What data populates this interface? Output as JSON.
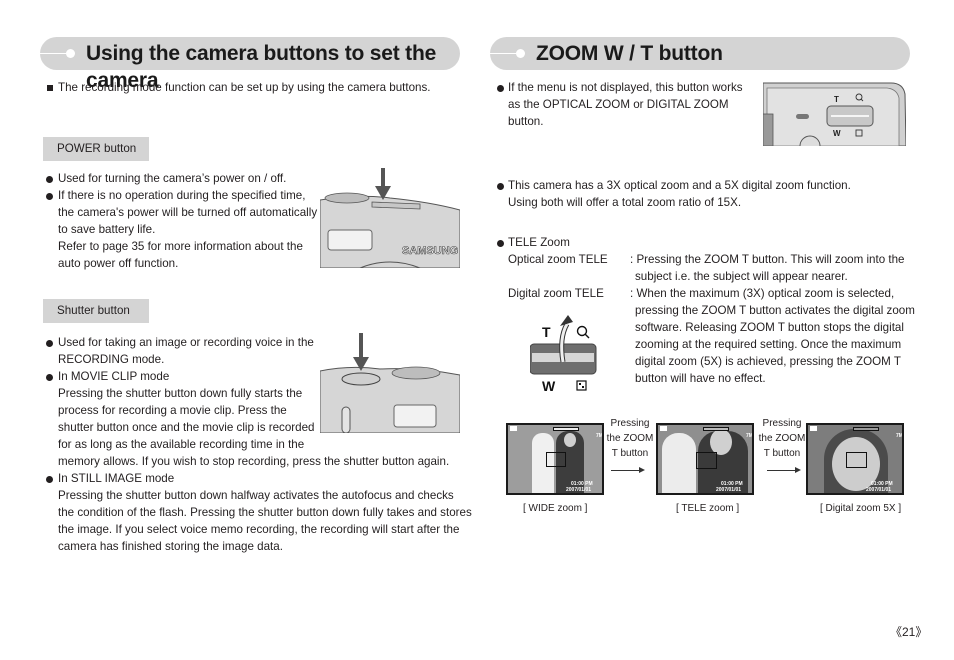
{
  "left": {
    "title": "Using the camera buttons to set the camera",
    "intro": "The recording mode function can be set up by using the camera buttons.",
    "power": {
      "label": "POWER button",
      "bullets": [
        [
          "Used for turning the camera’s power on / off."
        ],
        [
          "If there is no operation during the specified time,",
          "the camera's power will be turned off automatically",
          "to save battery life.",
          "Refer to page 35 for more information about the",
          "auto power off function."
        ]
      ],
      "illustration_brand": "SAMSUNG"
    },
    "shutter": {
      "label": "Shutter button",
      "bullets": [
        [
          "Used for taking an image or recording voice in the",
          "RECORDING mode."
        ],
        [
          "In MOVIE CLIP mode",
          "Pressing the shutter button down fully starts the",
          "process for recording a movie clip. Press the",
          "shutter button once and the movie clip is recorded",
          "for as long as the available recording time in the",
          "memory allows. If you wish to stop recording, press the shutter button again."
        ],
        [
          "In STILL IMAGE mode",
          "Pressing the shutter button down halfway activates the autofocus and checks",
          "the condition of the flash. Pressing the shutter button down fully takes and stores",
          "the image. If you select voice memo recording, the recording will start after the",
          "camera has finished storing the image data."
        ]
      ]
    }
  },
  "right": {
    "title": "ZOOM W / T button",
    "bullet1": [
      "If the menu is not displayed, this button works",
      "as the OPTICAL ZOOM or DIGITAL ZOOM",
      "button."
    ],
    "bullet2": [
      "This camera has a 3X optical zoom and a 5X digital zoom function.",
      "Using both will offer a total zoom ratio of 15X."
    ],
    "tele": {
      "heading": "TELE Zoom",
      "rows": [
        {
          "term": "Optical zoom TELE",
          "desc": [
            ": Pressing the ZOOM T button. This will zoom into the",
            "subject i.e. the subject will appear nearer."
          ]
        },
        {
          "term": "Digital zoom TELE",
          "desc": [
            ": When the maximum (3X) optical zoom is selected,",
            "pressing the ZOOM T button activates the digital zoom",
            "software. Releasing ZOOM T button stops the digital",
            "zooming at the required setting. Once the maximum",
            "digital zoom (5X) is achieved, pressing the ZOOM T",
            "button will have no effect."
          ]
        }
      ]
    },
    "button_labels": {
      "tele": "T",
      "wide": "W",
      "tele_icon": "magnifier-icon",
      "wide_icon": "thumbnail-grid-icon"
    },
    "sequence": {
      "shots": [
        {
          "caption": "[ WIDE zoom ]",
          "osd_time": "01:00 PM",
          "osd_date": "2007/01/01",
          "osd_size": "7M"
        },
        {
          "caption": "[ TELE zoom ]",
          "osd_time": "01:00 PM",
          "osd_date": "2007/01/01",
          "osd_size": "7M"
        },
        {
          "caption": "[ Digital zoom 5X ]",
          "osd_time": "01:00 PM",
          "osd_date": "2007/01/01",
          "osd_size": "7M"
        }
      ],
      "transition": [
        "Pressing",
        "the ZOOM",
        "T button"
      ]
    }
  },
  "page_number": "《21》"
}
